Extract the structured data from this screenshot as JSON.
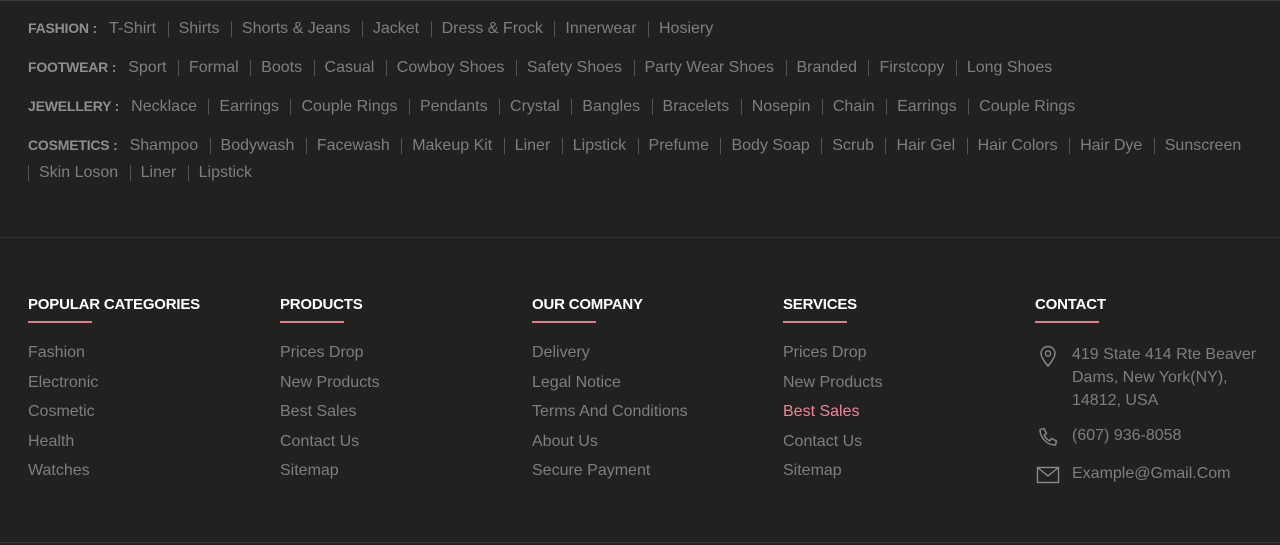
{
  "directory": [
    {
      "title": "FASHION :",
      "items": [
        "T-Shirt",
        "Shirts",
        "Shorts & Jeans",
        "Jacket",
        "Dress & Frock",
        "Innerwear",
        "Hosiery"
      ]
    },
    {
      "title": "FOOTWEAR :",
      "items": [
        "Sport",
        "Formal",
        "Boots",
        "Casual",
        "Cowboy Shoes",
        "Safety Shoes",
        "Party Wear Shoes",
        "Branded",
        "Firstcopy",
        "Long Shoes"
      ]
    },
    {
      "title": "JEWELLERY :",
      "items": [
        "Necklace",
        "Earrings",
        "Couple Rings",
        "Pendants",
        "Crystal",
        "Bangles",
        "Bracelets",
        "Nosepin",
        "Chain",
        "Earrings",
        "Couple Rings"
      ]
    },
    {
      "title": "COSMETICS :",
      "items": [
        "Shampoo",
        "Bodywash",
        "Facewash",
        "Makeup Kit",
        "Liner",
        "Lipstick",
        "Prefume",
        "Body Soap",
        "Scrub",
        "Hair Gel",
        "Hair Colors",
        "Hair Dye",
        "Sunscreen",
        "Skin Loson",
        "Liner",
        "Lipstick"
      ]
    }
  ],
  "columns": {
    "popular": {
      "title": "POPULAR CATEGORIES",
      "items": [
        "Fashion",
        "Electronic",
        "Cosmetic",
        "Health",
        "Watches"
      ]
    },
    "products": {
      "title": "PRODUCTS",
      "items": [
        "Prices Drop",
        "New Products",
        "Best Sales",
        "Contact Us",
        "Sitemap"
      ]
    },
    "company": {
      "title": "OUR COMPANY",
      "items": [
        "Delivery",
        "Legal Notice",
        "Terms And Conditions",
        "About Us",
        "Secure Payment"
      ]
    },
    "services": {
      "title": "SERVICES",
      "items": [
        "Prices Drop",
        "New Products",
        "Best Sales",
        "Contact Us",
        "Sitemap"
      ],
      "active_index": 2
    },
    "contact": {
      "title": "CONTACT",
      "address": "419 State 414 Rte Beaver Dams, New York(NY), 14812, USA",
      "phone": "(607) 936-8058",
      "email": "Example@Gmail.Com"
    }
  },
  "icons": {
    "address": "location-pin-icon",
    "phone": "phone-icon",
    "email": "mail-icon"
  },
  "colors": {
    "background": "#212121",
    "accent": "#f08594",
    "heading": "#ffffff",
    "text": "#7e7e7e"
  }
}
